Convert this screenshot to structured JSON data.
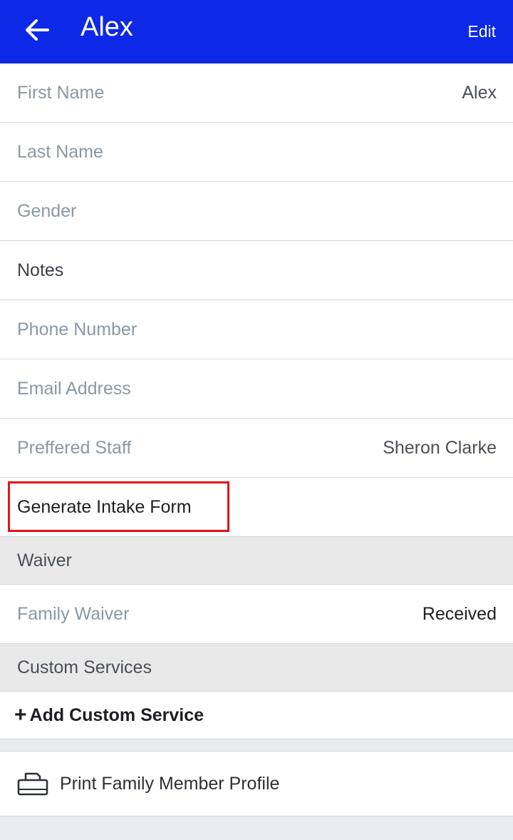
{
  "header": {
    "title": "Alex",
    "edit_label": "Edit",
    "back_icon": "arrow-left-icon"
  },
  "fields": [
    {
      "label": "First Name",
      "value": "Alex"
    },
    {
      "label": "Last Name",
      "value": ""
    },
    {
      "label": "Gender",
      "value": ""
    },
    {
      "label": "Notes",
      "value": ""
    },
    {
      "label": "Phone Number",
      "value": ""
    },
    {
      "label": "Email Address",
      "value": ""
    },
    {
      "label": "Preffered Staff",
      "value": "Sheron Clarke"
    },
    {
      "label": "Generate Intake Form",
      "value": ""
    }
  ],
  "waiver": {
    "section_title": "Waiver",
    "label": "Family Waiver",
    "value": "Received"
  },
  "custom_services": {
    "section_title": "Custom Services",
    "add_label": "Add Custom Service",
    "add_icon": "plus-icon"
  },
  "print": {
    "label": "Print Family Member Profile",
    "icon": "printer-icon"
  },
  "colors": {
    "header_bg": "#0d28e6",
    "highlight_border": "#e0141c",
    "section_bg": "#e9e9ea"
  }
}
